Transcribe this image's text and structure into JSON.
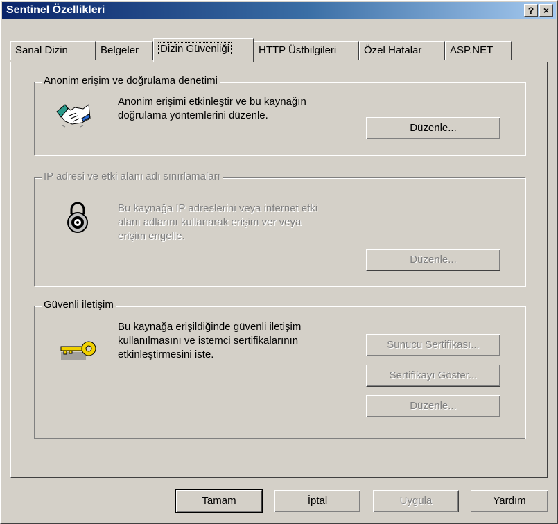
{
  "window": {
    "title": "Sentinel Özellikleri",
    "help_label": "?",
    "close_label": "×"
  },
  "tabs": [
    {
      "label": "Sanal Dizin"
    },
    {
      "label": "Belgeler"
    },
    {
      "label": "Dizin Güvenliği"
    },
    {
      "label": "HTTP Üstbilgileri"
    },
    {
      "label": "Özel Hatalar"
    },
    {
      "label": "ASP.NET"
    }
  ],
  "anon_group": {
    "title": "Anonim erişim ve doğrulama denetimi",
    "description_line1": "Anonim erişimi etkinleştir ve bu kaynağın",
    "description_line2": "doğrulama yöntemlerini düzenle.",
    "edit_label": "Düzenle...",
    "icon": "handshake-icon"
  },
  "ip_group": {
    "title": "IP adresi ve etki alanı adı sınırlamaları",
    "description_line1": "Bu kaynağa IP adreslerini veya internet etki",
    "description_line2": "alanı adlarını kullanarak erişim ver veya",
    "description_line3": "erişim engelle.",
    "edit_label": "Düzenle...",
    "icon": "padlock-icon"
  },
  "secure_group": {
    "title": "Güvenli iletişim",
    "description_line1": "Bu kaynağa erişildiğinde güvenli iletişim",
    "description_line2": "kullanılmasını ve istemci sertifikalarının",
    "description_line3": "etkinleştirmesini iste.",
    "server_cert_label": "Sunucu Sertifikası...",
    "view_cert_label": "Sertifikayı Göster...",
    "edit_label": "Düzenle...",
    "icon": "key-icon"
  },
  "footer": {
    "ok_label": "Tamam",
    "cancel_label": "İptal",
    "apply_label": "Uygula",
    "help_label": "Yardım"
  }
}
